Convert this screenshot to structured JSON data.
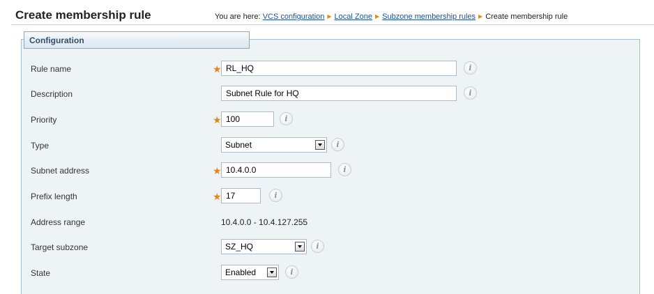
{
  "header": {
    "title": "Create membership rule",
    "breadcrumb_prefix": "You are here:",
    "breadcrumb": [
      {
        "label": "VCS configuration",
        "link": true
      },
      {
        "label": "Local Zone",
        "link": true
      },
      {
        "label": "Subzone membership rules",
        "link": true
      },
      {
        "label": "Create membership rule",
        "link": false
      }
    ]
  },
  "section": {
    "title": "Configuration"
  },
  "form": {
    "rule_name": {
      "label": "Rule name",
      "value": "RL_HQ",
      "required": true
    },
    "description": {
      "label": "Description",
      "value": "Subnet Rule for HQ",
      "required": false
    },
    "priority": {
      "label": "Priority",
      "value": "100",
      "required": true
    },
    "type": {
      "label": "Type",
      "value": "Subnet"
    },
    "subnet_address": {
      "label": "Subnet address",
      "value": "10.4.0.0",
      "required": true
    },
    "prefix_length": {
      "label": "Prefix length",
      "value": "17",
      "required": true
    },
    "address_range": {
      "label": "Address range",
      "value": "10.4.0.0 - 10.4.127.255"
    },
    "target_subzone": {
      "label": "Target subzone",
      "value": "SZ_HQ"
    },
    "state": {
      "label": "State",
      "value": "Enabled"
    }
  },
  "icons": {
    "info": "info-icon",
    "required": "required-star-icon",
    "separator": "breadcrumb-arrow-icon",
    "dropdown": "dropdown-arrow-icon"
  },
  "symbols": {
    "required": "★",
    "separator": "▶",
    "info": "i"
  },
  "colors": {
    "link": "#1a4f9c",
    "required_star": "#e88310",
    "panel_bg": "#eef3f6",
    "panel_border": "#a9bfcf"
  }
}
